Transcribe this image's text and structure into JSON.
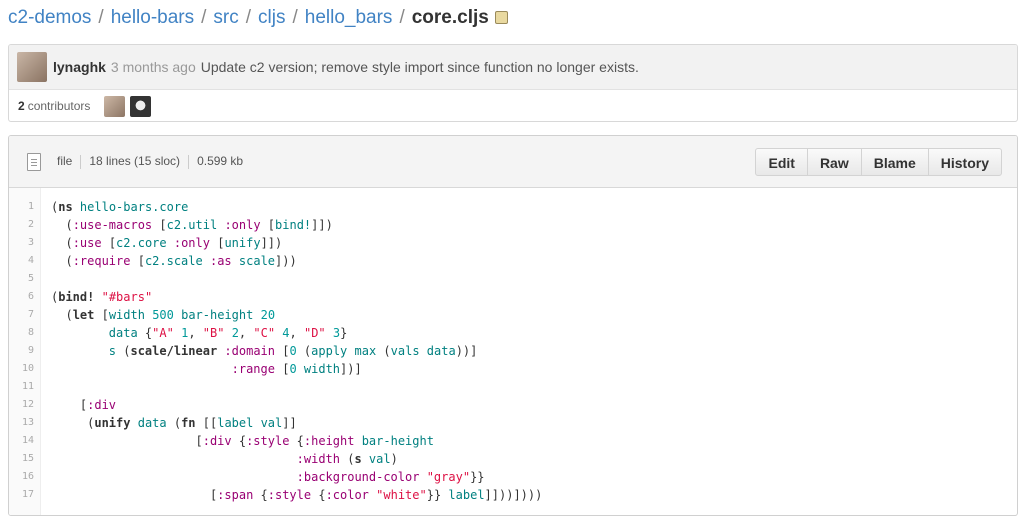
{
  "breadcrumb": {
    "repo": "c2-demos",
    "sep": "/",
    "p1": "hello-bars",
    "p2": "src",
    "p3": "cljs",
    "p4": "hello_bars",
    "file": "core.cljs"
  },
  "commit": {
    "author": "lynaghk",
    "age": "3 months ago",
    "message": "Update c2 version; remove style import since function no longer exists.",
    "contributors_count": "2",
    "contributors_label": "contributors"
  },
  "file": {
    "mode": "file",
    "lines": "18 lines (15 sloc)",
    "size": "0.599 kb",
    "buttons": [
      "Edit",
      "Raw",
      "Blame",
      "History"
    ]
  },
  "code": {
    "line_numbers": [
      "1",
      "2",
      "3",
      "4",
      "5",
      "6",
      "7",
      "8",
      "9",
      "10",
      "11",
      "12",
      "13",
      "14",
      "15",
      "16",
      "17"
    ]
  }
}
